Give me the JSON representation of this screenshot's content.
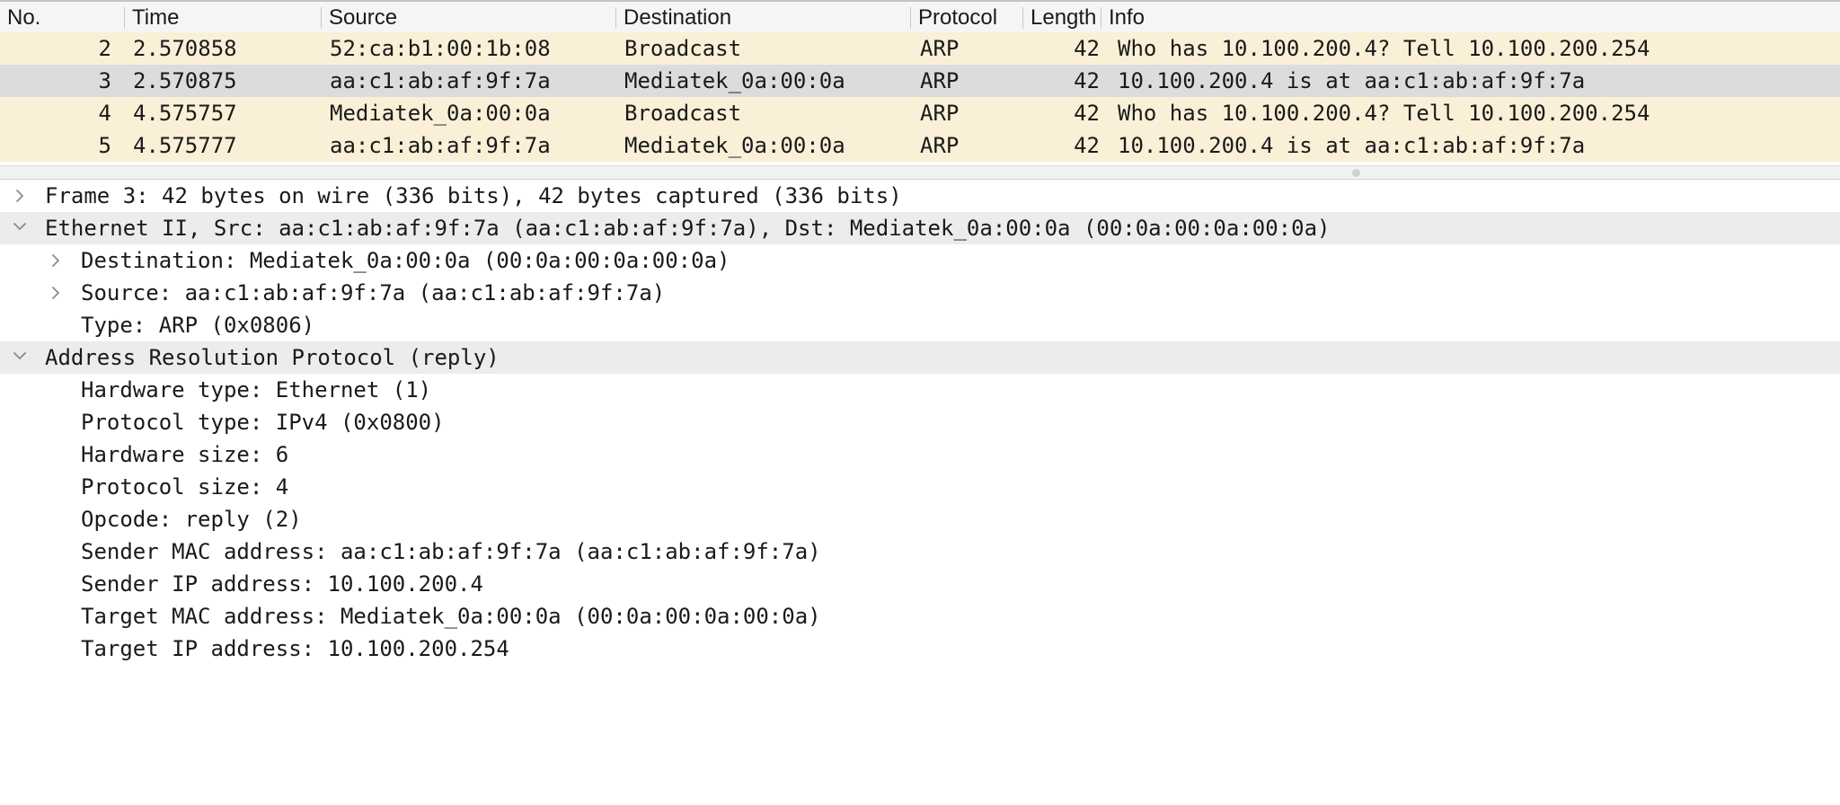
{
  "packet_list": {
    "columns": {
      "no": "No.",
      "time": "Time",
      "source": "Source",
      "destination": "Destination",
      "protocol": "Protocol",
      "length": "Length",
      "info": "Info"
    },
    "rows": [
      {
        "no": "2",
        "time": "2.570858",
        "source": "52:ca:b1:00:1b:08",
        "destination": "Broadcast",
        "protocol": "ARP",
        "length": "42",
        "info": "Who has 10.100.200.4? Tell 10.100.200.254"
      },
      {
        "no": "3",
        "time": "2.570875",
        "source": "aa:c1:ab:af:9f:7a",
        "destination": "Mediatek_0a:00:0a",
        "protocol": "ARP",
        "length": "42",
        "info": "10.100.200.4 is at aa:c1:ab:af:9f:7a"
      },
      {
        "no": "4",
        "time": "4.575757",
        "source": "Mediatek_0a:00:0a",
        "destination": "Broadcast",
        "protocol": "ARP",
        "length": "42",
        "info": "Who has 10.100.200.4? Tell 10.100.200.254"
      },
      {
        "no": "5",
        "time": "4.575777",
        "source": "aa:c1:ab:af:9f:7a",
        "destination": "Mediatek_0a:00:0a",
        "protocol": "ARP",
        "length": "42",
        "info": "10.100.200.4 is at aa:c1:ab:af:9f:7a"
      }
    ],
    "selected_row": "3",
    "colors": {
      "arp_row": "#faf0d7",
      "selected_row": "#dcdcdc"
    }
  },
  "detail_tree": {
    "frame": "Frame 3: 42 bytes on wire (336 bits), 42 bytes captured (336 bits)",
    "ethernet": "Ethernet II, Src: aa:c1:ab:af:9f:7a (aa:c1:ab:af:9f:7a), Dst: Mediatek_0a:00:0a (00:0a:00:0a:00:0a)",
    "eth_destination": "Destination: Mediatek_0a:00:0a (00:0a:00:0a:00:0a)",
    "eth_source": "Source: aa:c1:ab:af:9f:7a (aa:c1:ab:af:9f:7a)",
    "eth_type": "Type: ARP (0x0806)",
    "arp": "Address Resolution Protocol (reply)",
    "arp_fields": [
      "Hardware type: Ethernet (1)",
      "Protocol type: IPv4 (0x0800)",
      "Hardware size: 6",
      "Protocol size: 4",
      "Opcode: reply (2)",
      "Sender MAC address: aa:c1:ab:af:9f:7a (aa:c1:ab:af:9f:7a)",
      "Sender IP address: 10.100.200.4",
      "Target MAC address: Mediatek_0a:00:0a (00:0a:00:0a:00:0a)",
      "Target IP address: 10.100.200.254"
    ],
    "icons": {
      "collapsed": "chevron-right-icon",
      "expanded": "chevron-down-icon"
    }
  }
}
